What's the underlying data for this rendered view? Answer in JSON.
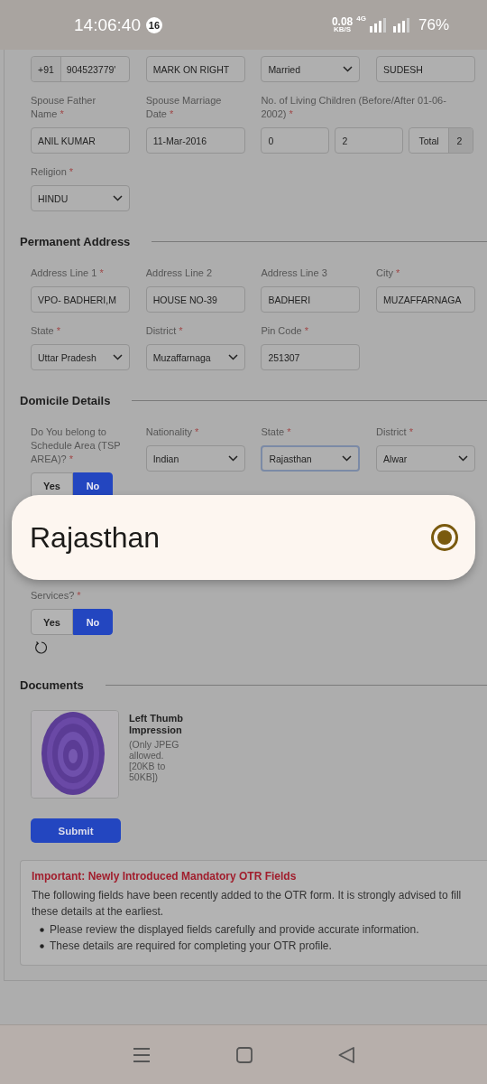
{
  "status_bar": {
    "time": "14:06:40",
    "notification_count": "16",
    "speed": "0.08",
    "speed_unit": "KB/S",
    "network": "4G",
    "battery": "76%"
  },
  "sections": [
    {
      "fields": [
        {
          "kind": "phone",
          "prefix": "+91",
          "value": "904523779'"
        },
        {
          "kind": "input",
          "value": "MARK ON RIGHT"
        },
        {
          "kind": "select",
          "value": "Married"
        },
        {
          "kind": "input",
          "value": "SUDESH"
        },
        {
          "kind": "input",
          "label": "Spouse Father Name",
          "required_mark": "*",
          "value": "ANIL KUMAR"
        },
        {
          "kind": "input",
          "label": "Spouse Marriage Date",
          "required_mark": "*",
          "value": "11-Mar-2016"
        },
        {
          "kind": "children",
          "label": "No. of Living Children (Before/After 01-06-2002)",
          "required_mark": "*",
          "before": "0",
          "after": "2",
          "total_label": "Total",
          "total": "2"
        },
        {
          "kind": "select",
          "label": "Religion",
          "required_mark": "*",
          "value": "HINDU"
        }
      ]
    },
    {
      "title": "Permanent Address",
      "fields": [
        {
          "kind": "input",
          "label": "Address Line 1",
          "required_mark": "*",
          "value": "VPO- BADHERI,M"
        },
        {
          "kind": "input",
          "label": "Address Line 2",
          "value": "HOUSE NO-39"
        },
        {
          "kind": "input",
          "label": "Address Line 3",
          "value": "BADHERI"
        },
        {
          "kind": "input",
          "label": "City",
          "required_mark": "*",
          "value": "MUZAFFARNAGA"
        },
        {
          "kind": "select",
          "label": "State",
          "required_mark": "*",
          "value": "Uttar Pradesh"
        },
        {
          "kind": "select",
          "label": "District",
          "required_mark": "*",
          "value": "Muzaffarnaga"
        },
        {
          "kind": "input",
          "label": "Pin Code",
          "required_mark": "*",
          "value": "251307"
        }
      ]
    },
    {
      "title": "Domicile Details",
      "fields": [
        {
          "kind": "toggle",
          "label": "Do You belong to Schedule Area (TSP AREA)?",
          "required_mark": "*",
          "options": [
            {
              "label": "Yes",
              "selected": false
            },
            {
              "label": "No",
              "selected": true
            }
          ]
        },
        {
          "kind": "select",
          "label": "Nationality",
          "required_mark": "*",
          "value": "Indian"
        },
        {
          "kind": "select",
          "label": "State",
          "required_mark": "*",
          "value": "Rajasthan",
          "focused": true
        },
        {
          "kind": "select",
          "label": "District",
          "required_mark": "*",
          "value": "Alwar"
        }
      ]
    },
    {
      "fields": [
        {
          "kind": "toggle",
          "label": "Services?",
          "required_mark": "*",
          "reset": true,
          "options": [
            {
              "label": "Yes",
              "selected": false
            },
            {
              "label": "No",
              "selected": true
            }
          ]
        }
      ]
    }
  ],
  "documents": {
    "title": "Documents",
    "items": [
      {
        "kind": "picture",
        "name": "Left Thumb Impression",
        "hint": "(Only JPEG allowed. [20KB to 50KB])"
      }
    ]
  },
  "submit": "Submit",
  "notice": {
    "title": "Important: Newly Introduced Mandatory OTR Fields",
    "text": "The following fields have been recently added to the OTR form. It is strongly advised to fill these details at the earliest.",
    "bullets": [
      "Please review the displayed fields carefully and provide accurate information.",
      "These details are required for completing your OTR profile."
    ]
  },
  "popup": {
    "options": [
      {
        "label": "Rajasthan",
        "selected": true
      }
    ]
  }
}
